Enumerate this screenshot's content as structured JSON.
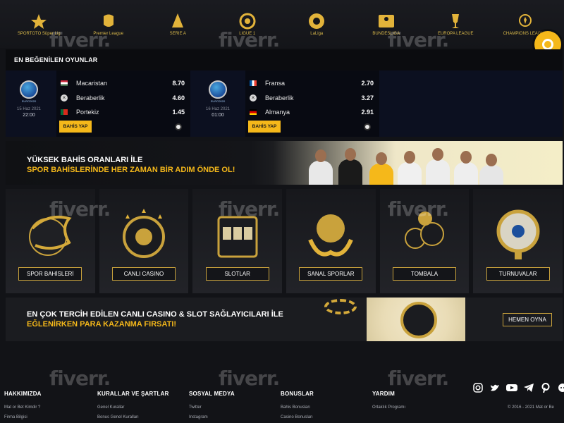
{
  "leagues": [
    {
      "name": "SPORTOTO Süper Lig",
      "icon": "sportoto-superlig-icon"
    },
    {
      "name": "Premier League",
      "icon": "premier-league-icon"
    },
    {
      "name": "SERIE A",
      "icon": "serie-a-icon"
    },
    {
      "name": "LIGUE 1",
      "icon": "ligue-1-icon"
    },
    {
      "name": "LaLiga",
      "icon": "laliga-icon"
    },
    {
      "name": "BUNDESLIGA",
      "icon": "bundesliga-icon"
    },
    {
      "name": "EUROPA LEAGUE",
      "icon": "europa-league-icon"
    },
    {
      "name": "CHAMPIONS LEAGUE",
      "icon": "champions-league-icon"
    }
  ],
  "popular": {
    "title": "EN BEĞENİLEN OYUNLAR",
    "matches": [
      {
        "competition": "EURO2020",
        "date": "15 Haz 2021",
        "time": "22:00",
        "outcomes": [
          {
            "team": "Macaristan",
            "odd": "8.70"
          },
          {
            "team": "Beraberlik",
            "odd": "4.60"
          },
          {
            "team": "Portekiz",
            "odd": "1.45"
          }
        ],
        "bet_label": "BAHİS YAP"
      },
      {
        "competition": "EURO2020",
        "date": "16 Haz 2021",
        "time": "01:00",
        "outcomes": [
          {
            "team": "Fransa",
            "odd": "2.70"
          },
          {
            "team": "Beraberlik",
            "odd": "3.27"
          },
          {
            "team": "Almanya",
            "odd": "2.91"
          }
        ],
        "bet_label": "BAHİS YAP"
      }
    ]
  },
  "banner1": {
    "line1": "YÜKSEK BAHİS ORANLARI İLE",
    "line2": "SPOR BAHİSLERİNDE HER ZAMAN BİR ADIM ÖNDE OL!"
  },
  "categories": [
    {
      "label": "SPOR BAHİSLERİ",
      "icon": "dragon-ball-icon"
    },
    {
      "label": "CANLI CASINO",
      "icon": "roulette-icon"
    },
    {
      "label": "SLOTLAR",
      "icon": "slot-machine-icon"
    },
    {
      "label": "SANAL SPORLAR",
      "icon": "golden-ball-icon"
    },
    {
      "label": "TOMBALA",
      "icon": "bingo-balls-icon"
    },
    {
      "label": "TURNUVALAR",
      "icon": "prize-wheel-icon"
    }
  ],
  "banner2": {
    "line1": "EN ÇOK TERCİH EDİLEN CANLI CASINO & SLOT SAĞLAYICILARI İLE",
    "line2": "EĞLENİRKEN PARA KAZANMA FIRSATI!",
    "cta": "HEMEN OYNA"
  },
  "footer": {
    "columns": [
      {
        "title": "HAKKIMIZDA",
        "links": [
          "Mat or Bet Kimdir ?",
          "Firma Bilgisi"
        ]
      },
      {
        "title": "KURALLAR VE ŞARTLAR",
        "links": [
          "Genel Kurallar",
          "Bonus Genel Kuralları"
        ]
      },
      {
        "title": "SOSYAL MEDYA",
        "links": [
          "Twitter",
          "Instagram"
        ]
      },
      {
        "title": "BONUSLAR",
        "links": [
          "Bahis Bonusları",
          "Casino Bonusları"
        ]
      },
      {
        "title": "YARDIM",
        "links": [
          "Ortaklık Programı"
        ]
      }
    ],
    "socials": [
      "instagram-icon",
      "twitter-icon",
      "youtube-icon",
      "telegram-icon",
      "pinterest-icon",
      "reddit-icon"
    ],
    "copyright": "© 2016 - 2021 Mat or Be"
  },
  "watermark": "fiverr.",
  "colors": {
    "accent": "#f5b81a",
    "gold": "#c9a23c",
    "background": "#121317"
  }
}
